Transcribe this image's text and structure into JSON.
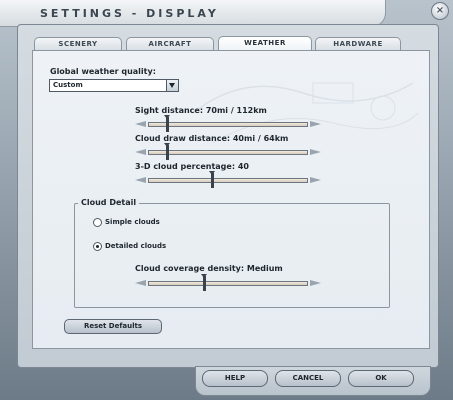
{
  "window": {
    "title": "SETTINGS - DISPLAY",
    "close_glyph": "×"
  },
  "tabs": [
    {
      "label": "SCENERY",
      "active": false
    },
    {
      "label": "AIRCRAFT",
      "active": false
    },
    {
      "label": "WEATHER",
      "active": true
    },
    {
      "label": "HARDWARE",
      "active": false
    }
  ],
  "weather": {
    "global_quality_label": "Global weather quality:",
    "global_quality_value": "Custom",
    "sight_distance_label": "Sight distance: 70mi / 112km",
    "sight_distance_level": 0.12,
    "cloud_draw_label": "Cloud draw distance: 40mi / 64km",
    "cloud_draw_level": 0.12,
    "cloud_percentage_label": "3-D cloud percentage: 40",
    "cloud_percentage_level": 0.4,
    "cloud_detail": {
      "title": "Cloud Detail",
      "simple_label": "Simple clouds",
      "detailed_label": "Detailed clouds",
      "selected": "detailed",
      "coverage_label": "Cloud coverage density: Medium",
      "coverage_level": 0.35
    },
    "reset_label": "Reset Defaults"
  },
  "footer": {
    "help_label": "HELP",
    "cancel_label": "CANCEL",
    "ok_label": "OK"
  },
  "colors": {
    "panel": "#eef2f6",
    "track": "#e6dccd",
    "thumb": "#3a434b",
    "frame": "#c2cbd3"
  }
}
